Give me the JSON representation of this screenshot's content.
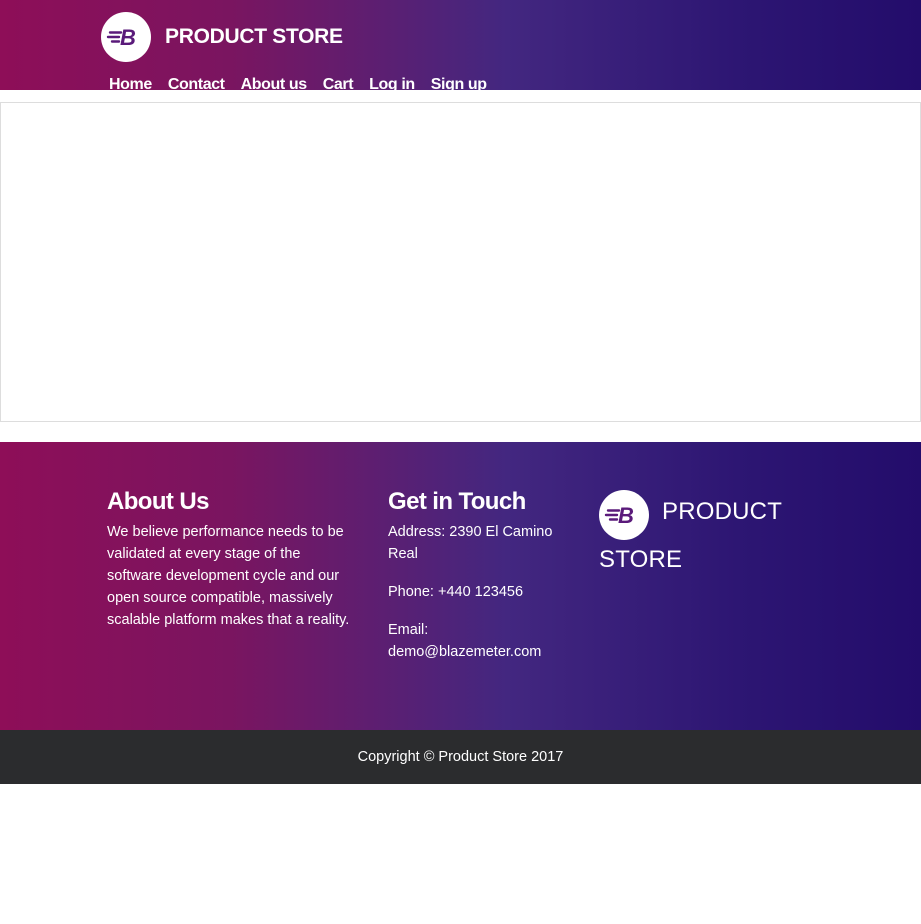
{
  "header": {
    "brand": "PRODUCT STORE",
    "logo_icon": "blazemeter-logo-icon",
    "nav": [
      {
        "label": "Home"
      },
      {
        "label": "Contact"
      },
      {
        "label": "About us"
      },
      {
        "label": "Cart"
      },
      {
        "label": "Log in"
      },
      {
        "label": "Sign up"
      }
    ]
  },
  "footer": {
    "about": {
      "title": "About Us",
      "text": "We believe performance needs to be validated at every stage of the software development cycle and our open source compatible, massively scalable platform makes that a reality."
    },
    "contact": {
      "title": "Get in Touch",
      "address": "Address: 2390 El Camino Real",
      "phone": "Phone: +440 123456",
      "email": "Email: demo@blazemeter.com"
    },
    "brand": "PRODUCT STORE",
    "copyright": "Copyright © Product Store 2017"
  },
  "colors": {
    "gradient_start": "#8e0e58",
    "gradient_end": "#230c6b",
    "logo_accent": "#5a1a7a",
    "copyright_bar": "#2b2c2e"
  }
}
